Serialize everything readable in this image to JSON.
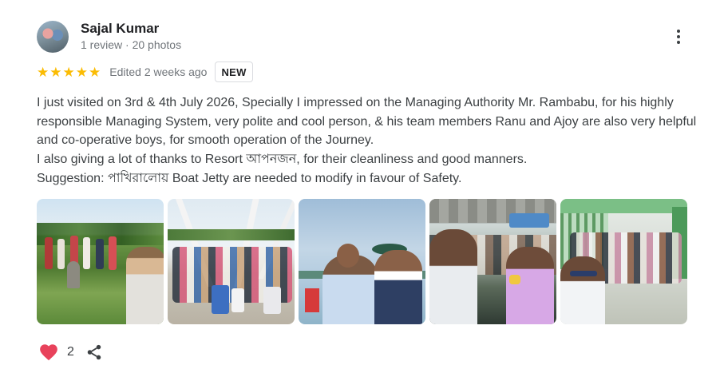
{
  "reviewer": {
    "name": "Sajal Kumar",
    "meta": "1 review · 20 photos"
  },
  "rating": {
    "stars": 5,
    "edited": "Edited 2 weeks ago",
    "badge": "NEW",
    "star_color": "#fbbc04"
  },
  "review": {
    "lines": [
      "I just visited on 3rd & 4th July 2026, Specially I impressed on the Managing Authority Mr. Rambabu, for his highly responsible Managing System, very polite and cool person, & his team members Ranu and Ajoy are also very helpful and co-operative boys, for smooth operation of the Journey.",
      "I also giving a lot of thanks to Resort আপনজন, for their cleanliness and good manners.",
      "Suggestion: পাখিরালোয় Boat Jetty are needed to modify in favour of Safety."
    ]
  },
  "photos": [
    {
      "icon": "photo-garden-group"
    },
    {
      "icon": "photo-tower-group"
    },
    {
      "icon": "photo-couple-selfie"
    },
    {
      "icon": "photo-boat-selfie"
    },
    {
      "icon": "photo-jetty-group"
    }
  ],
  "actions": {
    "like_count": "2",
    "heart_color": "#e8425b",
    "icons": [
      "heart-icon",
      "share-icon",
      "more-vert-icon"
    ]
  }
}
